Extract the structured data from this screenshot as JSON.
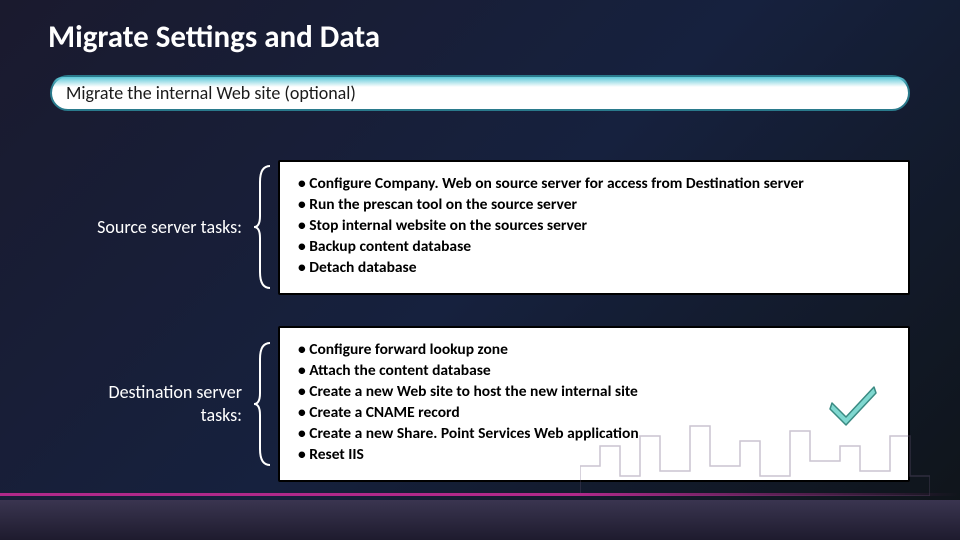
{
  "title": "Migrate Settings and Data",
  "subtitle": "Migrate the internal Web site (optional)",
  "source": {
    "label": "Source server tasks:",
    "items": {
      "0": "Configure Company. Web on source server for access from Destination server",
      "1": "Run the prescan tool on the source server",
      "2": "Stop internal website on the sources server",
      "3": "Backup content database",
      "4": "Detach database"
    }
  },
  "destination": {
    "label": "Destination server tasks:",
    "items": {
      "0": "Configure forward lookup zone",
      "1": " Attach the content database",
      "2": "Create a new Web site to host the new internal site",
      "3": "Create a CNAME record",
      "4": "Create a new Share. Point Services Web application",
      "5": "Reset IIS"
    }
  }
}
